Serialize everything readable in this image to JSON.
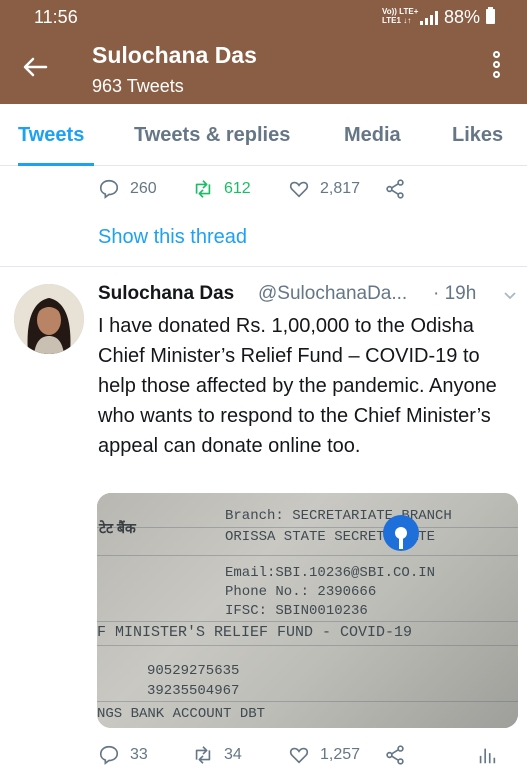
{
  "status_bar": {
    "time": "11:56",
    "network_line1": "Vo)) LTE+",
    "network_line2": "LTE1 ↓↑",
    "battery": "88%"
  },
  "header": {
    "title": "Sulochana Das",
    "subtitle": "963 Tweets",
    "back_icon": "arrow-left-icon",
    "more_icon": "more-vertical-icon"
  },
  "tabs": [
    {
      "label": "Tweets",
      "active": true
    },
    {
      "label": "Tweets & replies",
      "active": false
    },
    {
      "label": "Media",
      "active": false
    },
    {
      "label": "Likes",
      "active": false
    }
  ],
  "prev_tweet": {
    "replies": "260",
    "retweets": "612",
    "likes": "2,817",
    "show_thread": "Show this thread"
  },
  "tweet": {
    "author_name": "Sulochana Das",
    "author_handle": "@SulochanaDa...",
    "time": "· 19h",
    "text": "I have donated Rs. 1,00,000 to the Odisha Chief Minister’s Relief Fund – COVID-19 to help those affected by the pandemic. Anyone who wants to respond to the Chief Minister’s appeal can donate online too.",
    "media": {
      "hindi_text": "टेट बैंक",
      "line1": "Branch: SECRETARIATE BRANCH",
      "line2": "ORISSA STATE SECRETARIATE",
      "line3": "Email:SBI.10236@SBI.CO.IN",
      "line4": "Phone No.: 2390666",
      "line5": "IFSC: SBIN0010236",
      "line6": "F MINISTER'S RELIEF FUND - COVID-19",
      "line7": "90529275635",
      "line8": "39235504967",
      "line9": "NGS BANK ACCOUNT DBT"
    },
    "replies": "33",
    "retweets": "34",
    "likes": "1,257"
  },
  "colors": {
    "header_bg": "#8a5e44",
    "accent": "#1da1f2",
    "retweet_green": "#17bf63",
    "secondary_text": "#657786"
  }
}
